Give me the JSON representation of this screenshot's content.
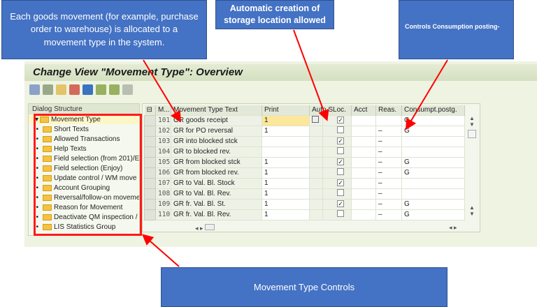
{
  "callouts": {
    "goods_movement": "Each goods movement (for example, purchase order to warehouse) is allocated to a movement type in the system.",
    "auto_sloc": "Automatic creation of storage location allowed",
    "consumption": "Controls Consumption posting-",
    "controls": "Movement Type Controls"
  },
  "window": {
    "title": "Change View \"Movement Type\": Overview"
  },
  "toolbar": {
    "icons": [
      "change-display-icon",
      "details-icon",
      "copy-icon",
      "delete-icon",
      "undo-icon",
      "select-all-icon",
      "select-block-icon",
      "deselect-all-icon"
    ]
  },
  "dialog_structure": {
    "header": "Dialog Structure",
    "root": "Movement Type",
    "items": [
      "Short Texts",
      "Allowed Transactions",
      "Help Texts",
      "Field selection (from 201)/E",
      "Field selection (Enjoy)",
      "Update control / WM move",
      "Account Grouping",
      "Reversal/follow-on moveme",
      "Reason for Movement",
      "Deactivate QM inspection /",
      "LIS Statistics Group"
    ]
  },
  "table": {
    "headers": [
      "M...",
      "Movement Type Text",
      "Print",
      "Auto.SLoc.",
      "Acct",
      "Reas.",
      "Consumpt.postg."
    ],
    "rows": [
      {
        "mv": "101",
        "text": "GR goods receipt",
        "print": "1",
        "sloc": true,
        "acct": "",
        "reas": "",
        "cons": "G"
      },
      {
        "mv": "102",
        "text": "GR for PO   reversal",
        "print": "1",
        "sloc": false,
        "acct": "",
        "reas": "–",
        "cons": "G"
      },
      {
        "mv": "103",
        "text": "GR into blocked stck",
        "print": "",
        "sloc": true,
        "acct": "",
        "reas": "–",
        "cons": ""
      },
      {
        "mv": "104",
        "text": "GR to blocked rev.",
        "print": "",
        "sloc": false,
        "acct": "",
        "reas": "–",
        "cons": ""
      },
      {
        "mv": "105",
        "text": "GR from blocked stck",
        "print": "1",
        "sloc": true,
        "acct": "",
        "reas": "–",
        "cons": "G"
      },
      {
        "mv": "106",
        "text": "GR from blocked rev.",
        "print": "1",
        "sloc": false,
        "acct": "",
        "reas": "–",
        "cons": "G"
      },
      {
        "mv": "107",
        "text": "GR to Val. Bl. Stock",
        "print": "1",
        "sloc": true,
        "acct": "",
        "reas": "–",
        "cons": ""
      },
      {
        "mv": "108",
        "text": "GR to Val. Bl. Rev.",
        "print": "1",
        "sloc": false,
        "acct": "",
        "reas": "–",
        "cons": ""
      },
      {
        "mv": "109",
        "text": "GR fr. Val. Bl. St.",
        "print": "1",
        "sloc": true,
        "acct": "",
        "reas": "–",
        "cons": "G"
      },
      {
        "mv": "110",
        "text": "GR fr. Val. Bl. Rev.",
        "print": "1",
        "sloc": false,
        "acct": "",
        "reas": "–",
        "cons": "G"
      }
    ]
  },
  "colors": {
    "callout": "#4472c4",
    "arrow": "#ff0000",
    "highlight": "#fce79a"
  }
}
